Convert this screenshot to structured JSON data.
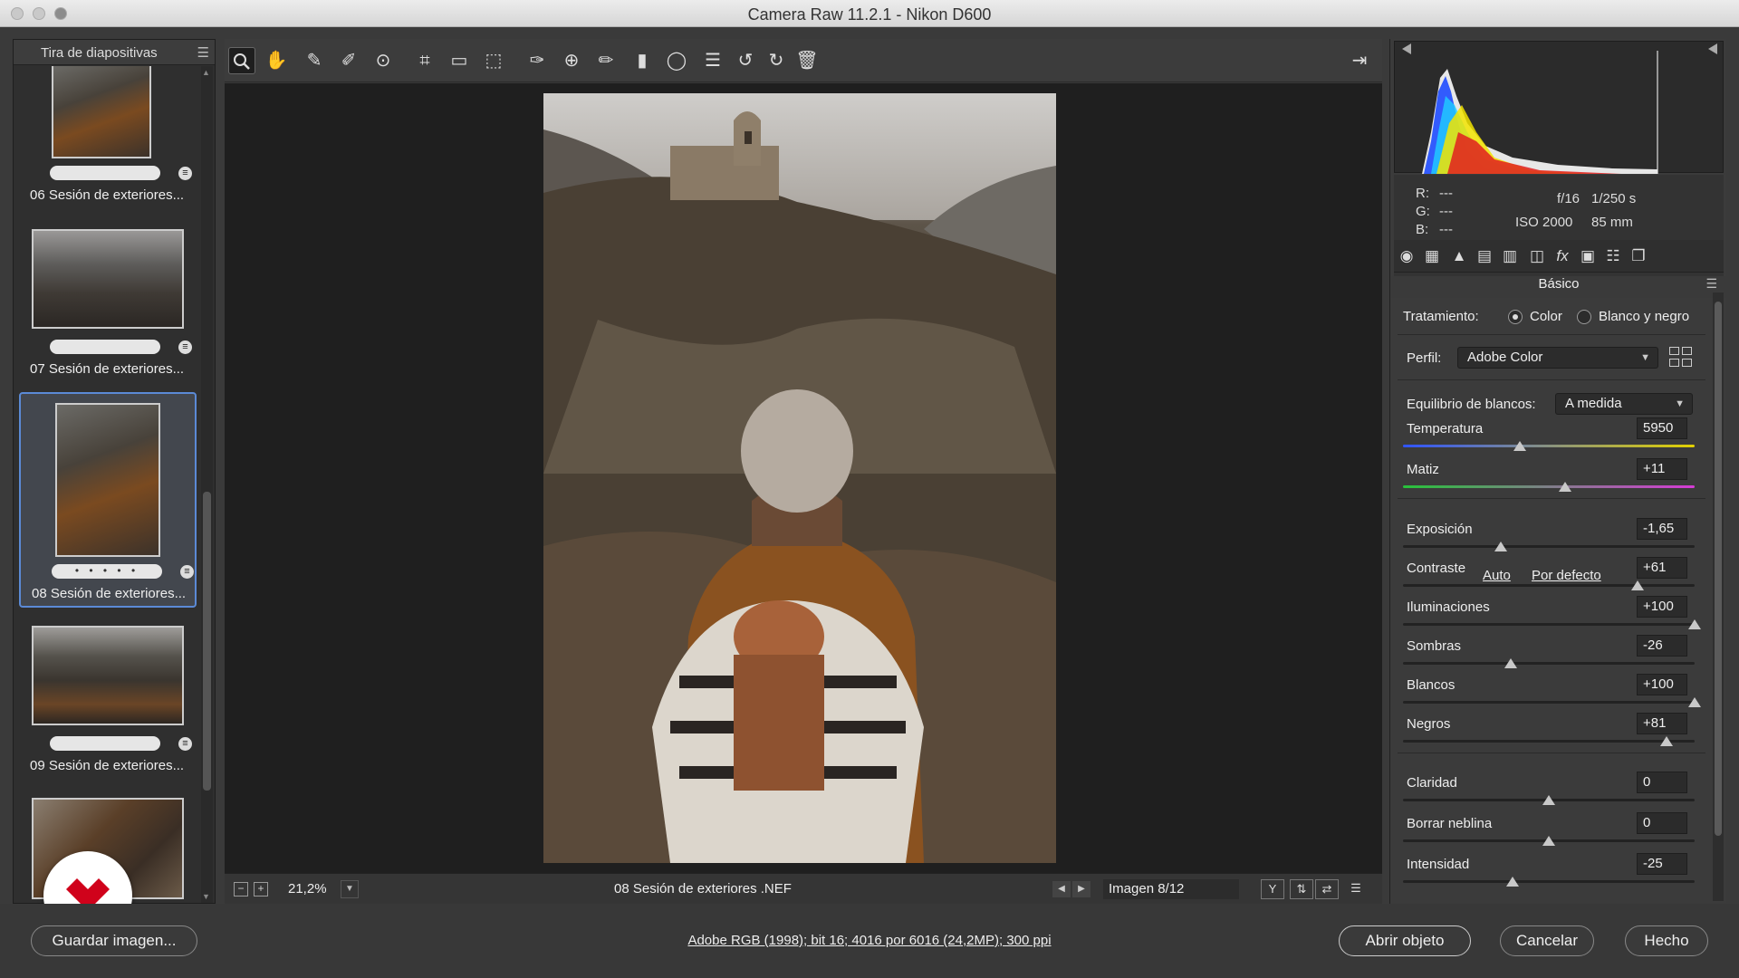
{
  "window": {
    "title": "Camera Raw 11.2.1 -  Nikon D600"
  },
  "filmstrip": {
    "title": "Tira de diapositivas",
    "items": [
      {
        "name": "06 Sesión de exteriores...",
        "rating": ""
      },
      {
        "name": "07 Sesión de exteriores...",
        "rating": ""
      },
      {
        "name": "08 Sesión de exteriores...",
        "rating": "• • • • •",
        "selected": true
      },
      {
        "name": "09 Sesión de exteriores...",
        "rating": ""
      }
    ]
  },
  "toolbar": {
    "tools": [
      "zoom-tool",
      "hand-tool",
      "white-balance-tool",
      "color-sampler-tool",
      "targeted-adjustment-tool",
      "crop-tool",
      "straighten-tool",
      "transform-tool",
      "spot-removal-tool",
      "red-eye-tool",
      "adjustment-brush",
      "graduated-filter",
      "radial-filter",
      "presets-menu",
      "rotate-left",
      "rotate-right",
      "delete"
    ]
  },
  "statusbar": {
    "zoom": "21,2%",
    "filename": "08 Sesión de exteriores .NEF",
    "image_counter": "Imagen 8/12"
  },
  "camera_info": {
    "r_label": "R:",
    "r_value": "---",
    "g_label": "G:",
    "g_value": "---",
    "b_label": "B:",
    "b_value": "---",
    "aperture": "f/16",
    "shutter": "1/250 s",
    "iso": "ISO 2000",
    "focal": "85 mm"
  },
  "panel": {
    "title": "Básico",
    "treatment_label": "Tratamiento:",
    "treatment_color": "Color",
    "treatment_bw": "Blanco y negro",
    "profile_label": "Perfil:",
    "profile_value": "Adobe Color",
    "wb_label": "Equilibrio de blancos:",
    "wb_value": "A medida",
    "auto": "Auto",
    "default": "Por defecto",
    "sliders": [
      {
        "label": "Temperatura",
        "value": "5950",
        "pos": 0.4
      },
      {
        "label": "Matiz",
        "value": "+11",
        "pos": 0.555
      },
      {
        "label": "Exposición",
        "value": "-1,65",
        "pos": 0.335
      },
      {
        "label": "Contraste",
        "value": "+61",
        "pos": 0.805
      },
      {
        "label": "Iluminaciones",
        "value": "+100",
        "pos": 1.0
      },
      {
        "label": "Sombras",
        "value": "-26",
        "pos": 0.37
      },
      {
        "label": "Blancos",
        "value": "+100",
        "pos": 1.0
      },
      {
        "label": "Negros",
        "value": "+81",
        "pos": 0.905
      },
      {
        "label": "Claridad",
        "value": "0",
        "pos": 0.5
      },
      {
        "label": "Borrar neblina",
        "value": "0",
        "pos": 0.5
      },
      {
        "label": "Intensidad",
        "value": "-25",
        "pos": 0.375
      }
    ]
  },
  "bottom": {
    "save_label": "Guardar imagen...",
    "workflow": "Adobe RGB (1998); bit 16; 4016 por 6016 (24,2MP); 300 ppi",
    "open_label": "Abrir objeto",
    "cancel_label": "Cancelar",
    "done_label": "Hecho"
  },
  "colors": {
    "selection_border": "#5b8ad6",
    "panel_bg": "#3b3b3b",
    "canvas_bg": "#1f1f1f",
    "logo_red": "#d0021b"
  }
}
